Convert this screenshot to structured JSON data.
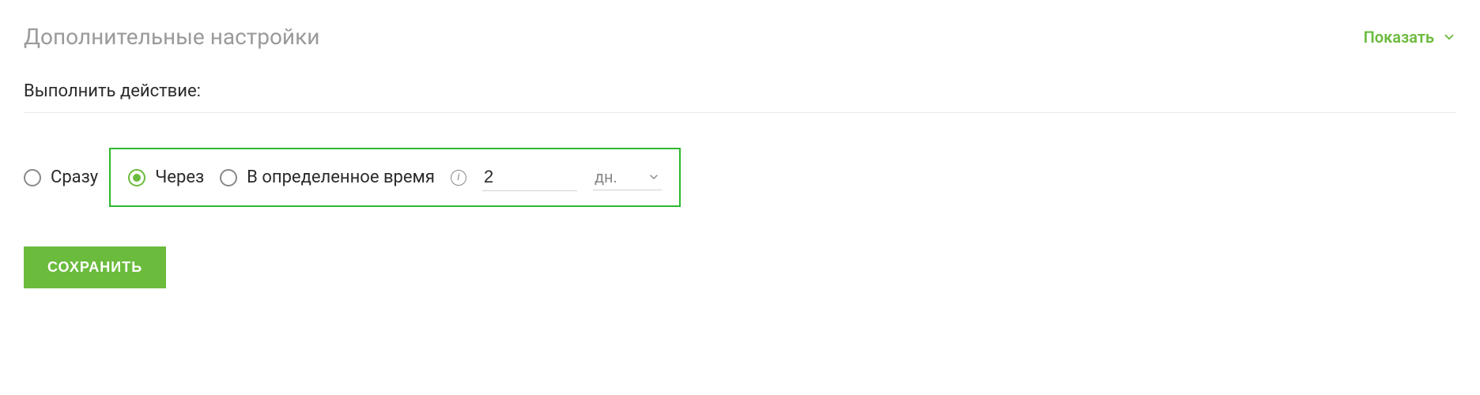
{
  "header": {
    "title": "Дополнительные настройки",
    "toggle_label": "Показать"
  },
  "action": {
    "label": "Выполнить действие:"
  },
  "options": {
    "immediately": "Сразу",
    "after": "Через",
    "at_time": "В определенное время",
    "value": "2",
    "unit": "дн."
  },
  "buttons": {
    "save": "СОХРАНИТЬ"
  }
}
